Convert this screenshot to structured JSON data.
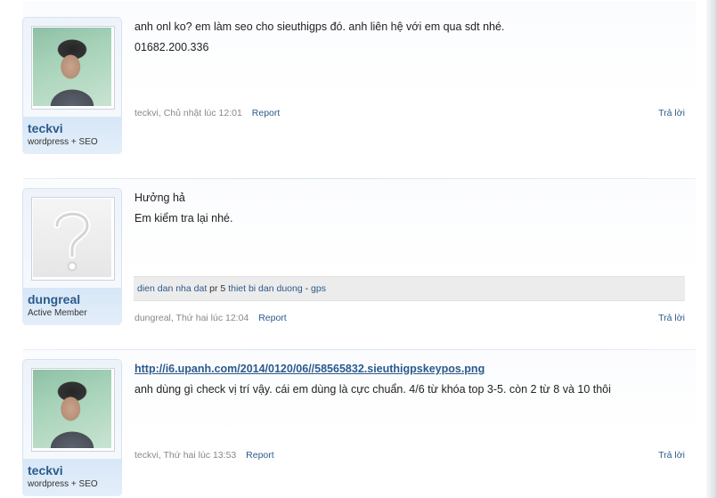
{
  "posts": [
    {
      "username": "teckvi",
      "user_title": "wordpress + SEO",
      "avatar": "user-photo",
      "message_lines": [
        "anh onl ko? em làm seo cho sieuthigps đó. anh liên hệ với em qua sdt nhé.",
        "01682.200.336"
      ],
      "meta": {
        "author": "teckvi",
        "sep": ", ",
        "date": "Chủ nhật lúc 12:01",
        "report": "Report",
        "reply": "Trả lời"
      }
    },
    {
      "username": "dungreal",
      "user_title": "Active Member",
      "avatar": "default-question-mark",
      "message_lines": [
        "Hưởng hả",
        "Em kiểm tra lại nhé."
      ],
      "signature": {
        "link1": "dien dan nha dat",
        "text1": " pr 5 ",
        "link2": "thiet bi dan duong",
        "text2": " - ",
        "link3": "gps"
      },
      "meta": {
        "author": "dungreal",
        "sep": ", ",
        "date": "Thứ hai lúc 12:04",
        "report": "Report",
        "reply": "Trả lời"
      }
    },
    {
      "username": "teckvi",
      "user_title": "wordpress + SEO",
      "avatar": "user-photo",
      "link": "http://i6.upanh.com/2014/0120/06//58565832.sieuthigpskeypos.png",
      "message_lines": [
        "anh dùng gì check vị trí vậy. cái em dùng là cực chuẩn. 4/6 từ khóa top 3-5. còn 2 từ 8 và 10 thôi"
      ],
      "meta": {
        "author": "teckvi",
        "sep": ", ",
        "date": "Thứ hai lúc 13:53",
        "report": "Report",
        "reply": "Trả lời"
      }
    }
  ],
  "colors": {
    "link": "#2b5a8c",
    "card_bg": "#e4eefa",
    "meta": "#888888"
  }
}
